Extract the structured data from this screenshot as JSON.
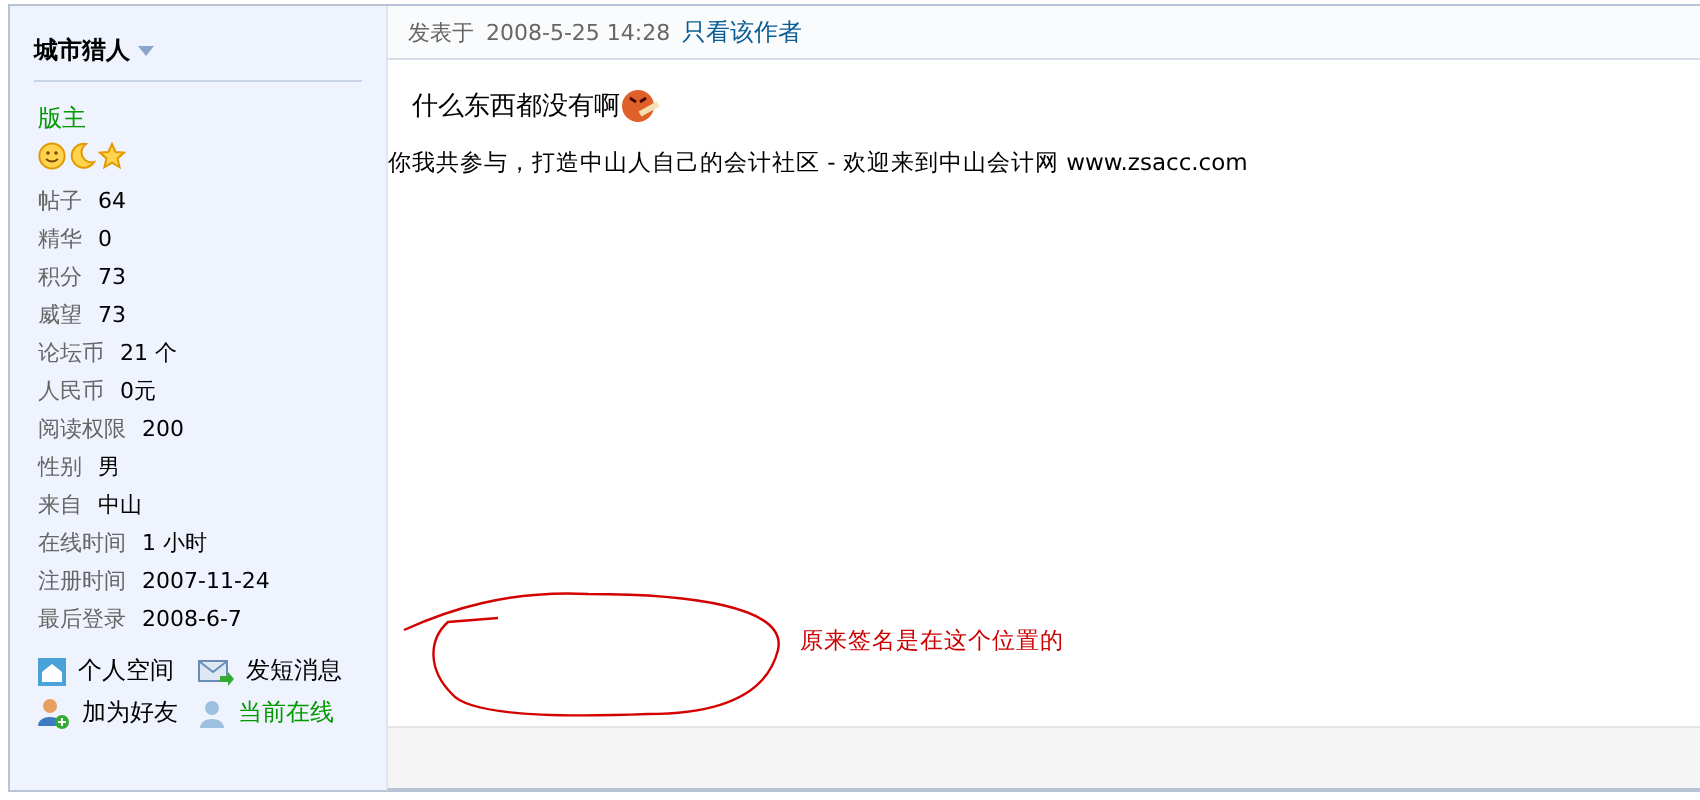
{
  "author": {
    "name": "城市猎人",
    "group": "版主",
    "stats": [
      {
        "label": "帖子",
        "value": "64"
      },
      {
        "label": "精华",
        "value": "0"
      },
      {
        "label": "积分",
        "value": "73"
      },
      {
        "label": "威望",
        "value": "73"
      },
      {
        "label": "论坛币",
        "value": "21 个"
      },
      {
        "label": "人民币",
        "value": "0元"
      },
      {
        "label": "阅读权限",
        "value": "200"
      },
      {
        "label": "性别",
        "value": "男"
      },
      {
        "label": "来自",
        "value": "中山"
      },
      {
        "label": "在线时间",
        "value": "1 小时"
      },
      {
        "label": "注册时间",
        "value": "2007-11-24"
      },
      {
        "label": "最后登录",
        "value": "2008-6-7"
      }
    ],
    "actions": [
      {
        "label": "个人空间",
        "kind": "link"
      },
      {
        "label": "发短消息",
        "kind": "link"
      },
      {
        "label": "加为好友",
        "kind": "link"
      },
      {
        "label": "当前在线",
        "kind": "status"
      }
    ]
  },
  "post": {
    "posted_label": "发表于",
    "time": "2008-5-25 14:28",
    "author_only": "只看该作者",
    "message": "什么东西都没有啊",
    "signature": "你我共参与，打造中山人自己的会计社区  - 欢迎来到中山会计网  www.zsacc.com",
    "annotation": "原来签名是在这个位置的"
  }
}
